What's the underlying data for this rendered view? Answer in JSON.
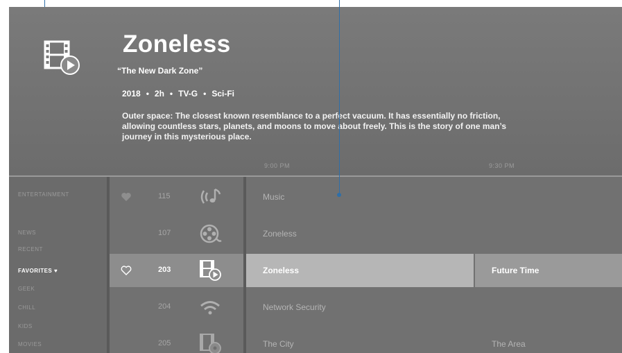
{
  "program": {
    "title": "Zoneless",
    "episode": "“The New Dark Zone”",
    "year": "2018",
    "duration": "2h",
    "rating": "TV-G",
    "genre": "Sci-Fi",
    "separator": "•",
    "description": "Outer space: The closest known resemblance to a perfect vacuum. It has essentially no friction, allowing countless stars, planets, and moons to move about freely. This is the story of one man’s journey in this mysterious place."
  },
  "timeline": {
    "slot1": "9:00 PM",
    "slot2": "9:30 PM"
  },
  "categories": [
    {
      "label": "ENTERTAINMENT"
    },
    {
      "label": "NEWS"
    },
    {
      "label": "RECENT"
    },
    {
      "label": "FAVORITES ♥"
    },
    {
      "label": "GEEK"
    },
    {
      "label": "CHILL"
    },
    {
      "label": "KIDS"
    },
    {
      "label": "MOVIES"
    }
  ],
  "channels": [
    {
      "number": "115",
      "icon": "music-radio-icon",
      "program": "Music",
      "next": ""
    },
    {
      "number": "107",
      "icon": "film-reel-icon",
      "program": "Zoneless",
      "next": ""
    },
    {
      "number": "203",
      "icon": "film-play-icon",
      "program": "Zoneless",
      "next": "Future Time"
    },
    {
      "number": "204",
      "icon": "wifi-icon",
      "program": "Network Security",
      "next": ""
    },
    {
      "number": "205",
      "icon": "film-disc-icon",
      "program": "The City",
      "next": "The Area"
    }
  ],
  "colors": {
    "callout": "#2f6fa8",
    "background": "#6f6f6f",
    "selected_row": "#b6b6b6"
  }
}
